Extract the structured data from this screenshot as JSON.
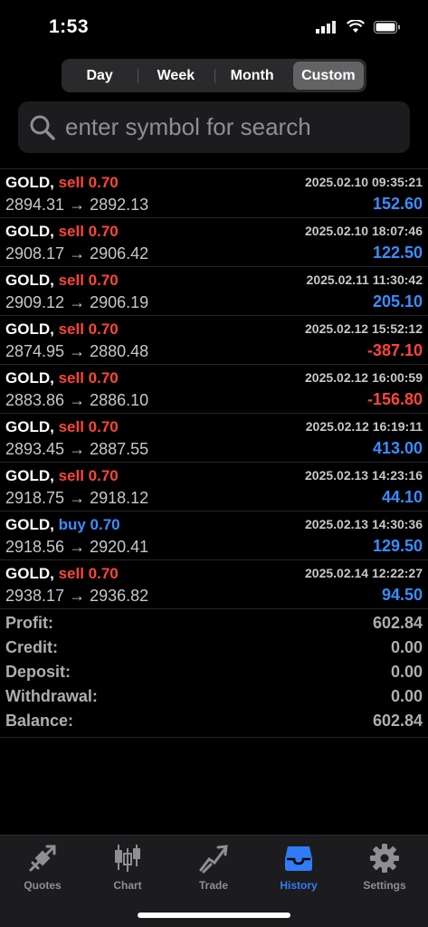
{
  "status_bar": {
    "time": "1:53"
  },
  "period_tabs": [
    {
      "label": "Day",
      "active": false
    },
    {
      "label": "Week",
      "active": false
    },
    {
      "label": "Month",
      "active": false
    },
    {
      "label": "Custom",
      "active": true
    }
  ],
  "search": {
    "placeholder": "enter symbol for search",
    "value": ""
  },
  "deals": [
    {
      "symbol": "GOLD,",
      "side": "sell 0.70",
      "type": "sell",
      "time": "2025.02.10 09:35:21",
      "open": "2894.31",
      "arrow": "→",
      "close": "2892.13",
      "profit": "152.60",
      "profit_sign": "pos"
    },
    {
      "symbol": "GOLD,",
      "side": "sell 0.70",
      "type": "sell",
      "time": "2025.02.10 18:07:46",
      "open": "2908.17",
      "arrow": "→",
      "close": "2906.42",
      "profit": "122.50",
      "profit_sign": "pos"
    },
    {
      "symbol": "GOLD,",
      "side": "sell 0.70",
      "type": "sell",
      "time": "2025.02.11 11:30:42",
      "open": "2909.12",
      "arrow": "→",
      "close": "2906.19",
      "profit": "205.10",
      "profit_sign": "pos"
    },
    {
      "symbol": "GOLD,",
      "side": "sell 0.70",
      "type": "sell",
      "time": "2025.02.12 15:52:12",
      "open": "2874.95",
      "arrow": "→",
      "close": "2880.48",
      "profit": "-387.10",
      "profit_sign": "neg"
    },
    {
      "symbol": "GOLD,",
      "side": "sell 0.70",
      "type": "sell",
      "time": "2025.02.12 16:00:59",
      "open": "2883.86",
      "arrow": "→",
      "close": "2886.10",
      "profit": "-156.80",
      "profit_sign": "neg"
    },
    {
      "symbol": "GOLD,",
      "side": "sell 0.70",
      "type": "sell",
      "time": "2025.02.12 16:19:11",
      "open": "2893.45",
      "arrow": "→",
      "close": "2887.55",
      "profit": "413.00",
      "profit_sign": "pos"
    },
    {
      "symbol": "GOLD,",
      "side": "sell 0.70",
      "type": "sell",
      "time": "2025.02.13 14:23:16",
      "open": "2918.75",
      "arrow": "→",
      "close": "2918.12",
      "profit": "44.10",
      "profit_sign": "pos"
    },
    {
      "symbol": "GOLD,",
      "side": "buy 0.70",
      "type": "buy",
      "time": "2025.02.13 14:30:36",
      "open": "2918.56",
      "arrow": "→",
      "close": "2920.41",
      "profit": "129.50",
      "profit_sign": "pos"
    },
    {
      "symbol": "GOLD,",
      "side": "sell 0.70",
      "type": "sell",
      "time": "2025.02.14 12:22:27",
      "open": "2938.17",
      "arrow": "→",
      "close": "2936.82",
      "profit": "94.50",
      "profit_sign": "pos"
    }
  ],
  "summary": [
    {
      "label": "Profit:",
      "value": "602.84"
    },
    {
      "label": "Credit:",
      "value": "0.00"
    },
    {
      "label": "Deposit:",
      "value": "0.00"
    },
    {
      "label": "Withdrawal:",
      "value": "0.00"
    },
    {
      "label": "Balance:",
      "value": "602.84"
    }
  ],
  "tabbar": {
    "items": [
      {
        "label": "Quotes",
        "icon": "quotes-icon",
        "active": false
      },
      {
        "label": "Chart",
        "icon": "candlestick-chart-icon",
        "active": false
      },
      {
        "label": "Trade",
        "icon": "trade-icon",
        "active": false
      },
      {
        "label": "History",
        "icon": "history-inbox-icon",
        "active": true
      },
      {
        "label": "Settings",
        "icon": "gear-icon",
        "active": false
      }
    ]
  },
  "colors": {
    "background": "#000000",
    "sell": "#ff453a",
    "buy": "#3a8dff",
    "profit_positive": "#3a8dff",
    "profit_negative": "#ff453a",
    "tab_active": "#2f7df6",
    "tab_inactive": "#8e8e93"
  }
}
